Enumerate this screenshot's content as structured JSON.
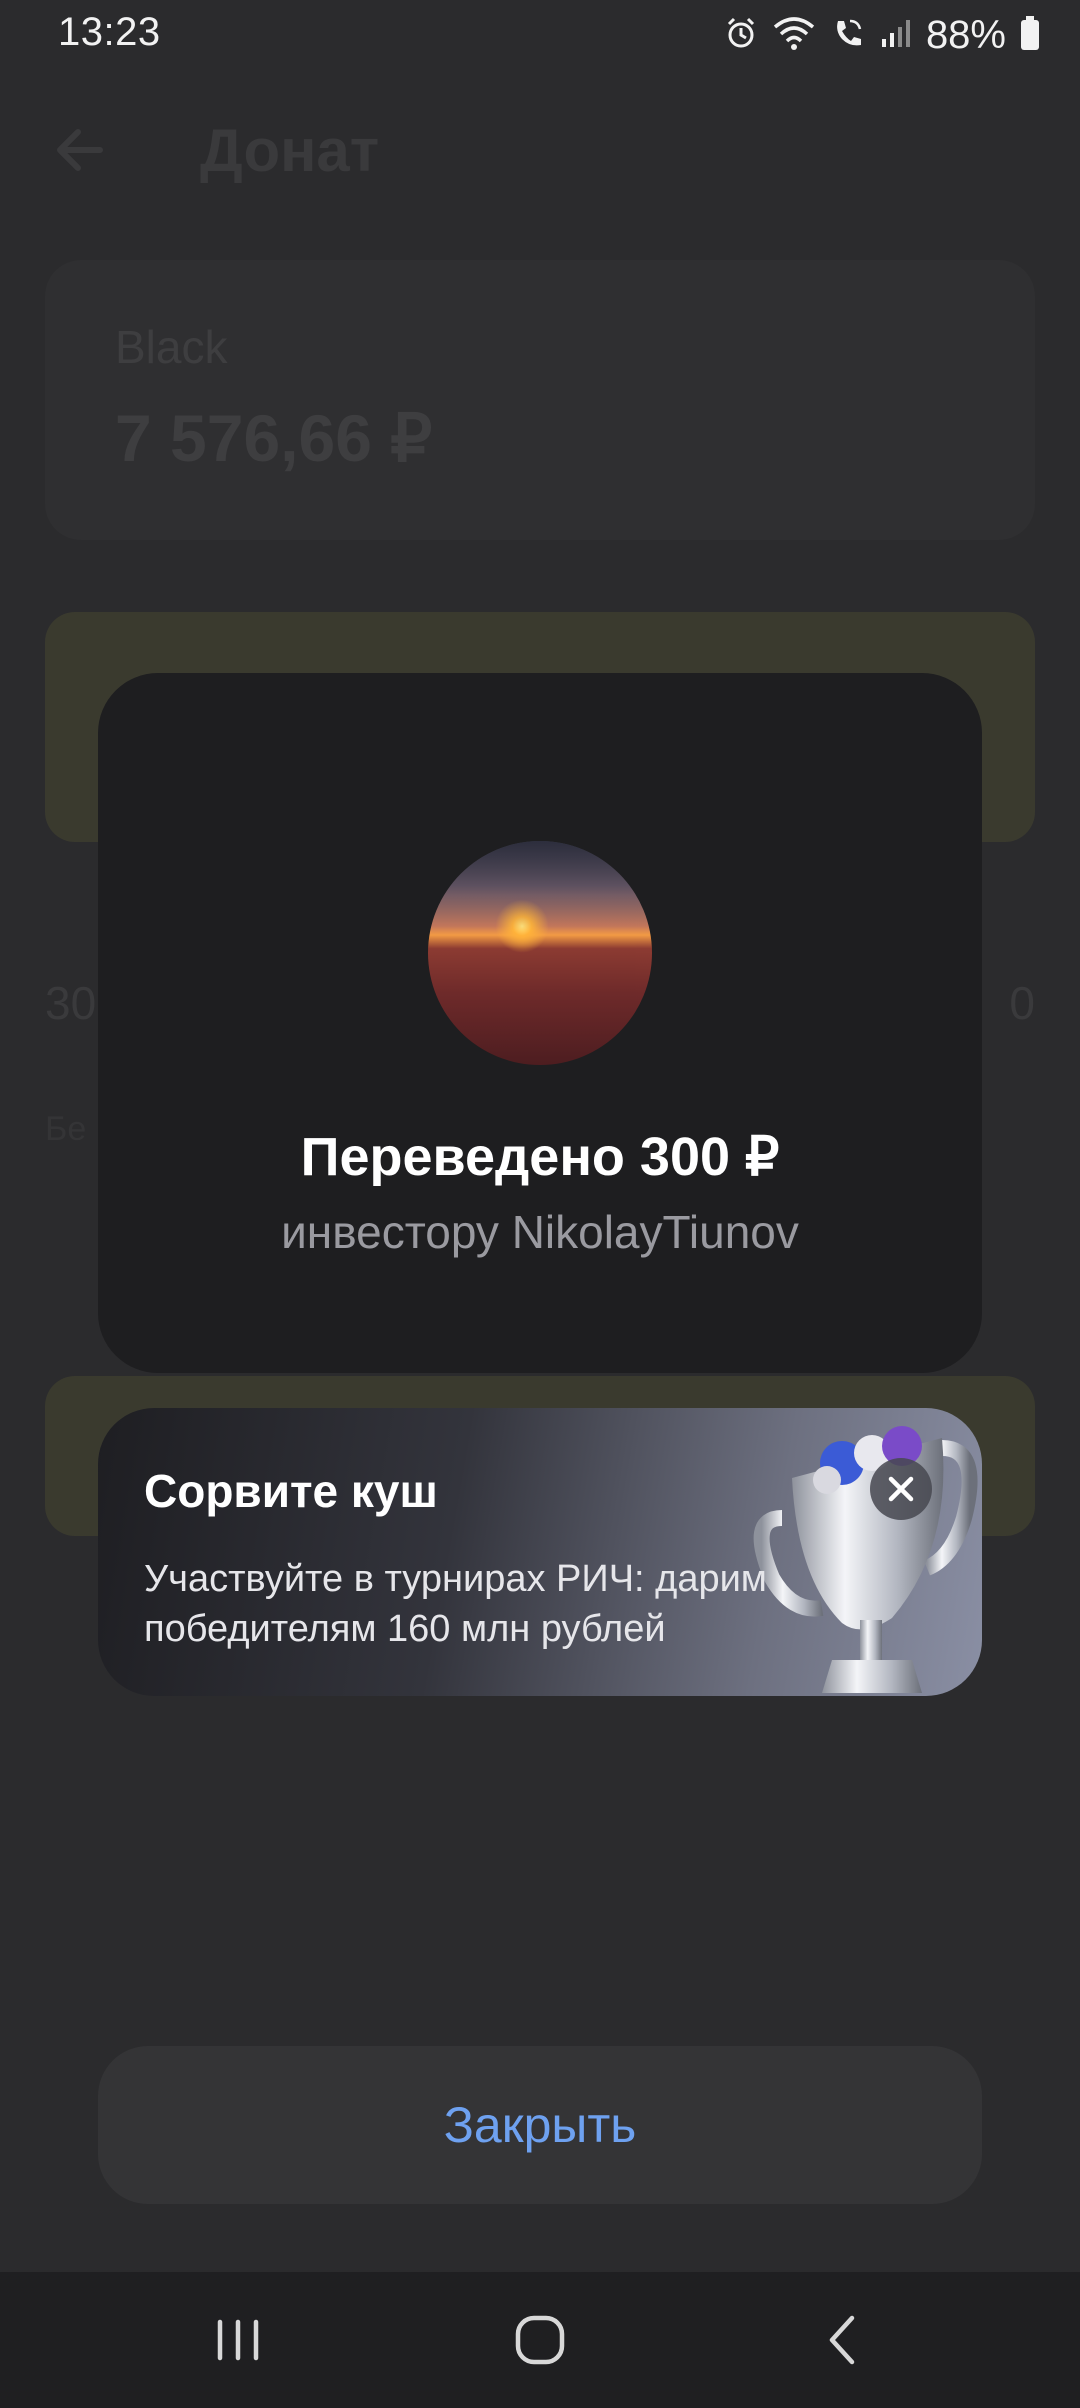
{
  "status_bar": {
    "time": "13:23",
    "battery": "88%"
  },
  "background_screen": {
    "title": "Донат",
    "card_label": "Black",
    "card_amount": "7 576,66 ₽",
    "faint_left": "30",
    "faint_right": "0",
    "faint_small": "Бе"
  },
  "modal": {
    "title": "Переведено 300 ₽",
    "subtitle": "инвестору NikolayTiunov"
  },
  "promo": {
    "title": "Сорвите куш",
    "text": "Участвуйте в турнирах РИЧ: дарим победителям 160 млн рублей"
  },
  "close_button": {
    "label": "Закрыть"
  },
  "colors": {
    "accent_link": "#6ea1f0",
    "modal_bg": "#1e1e20",
    "overlay_bg": "#2b2b2d"
  },
  "icons": {
    "status": [
      "alarm-icon",
      "wifi-icon",
      "wifi-calling-icon",
      "signal-icon",
      "battery-icon"
    ],
    "nav": [
      "recent-apps-icon",
      "home-icon",
      "back-icon"
    ]
  }
}
